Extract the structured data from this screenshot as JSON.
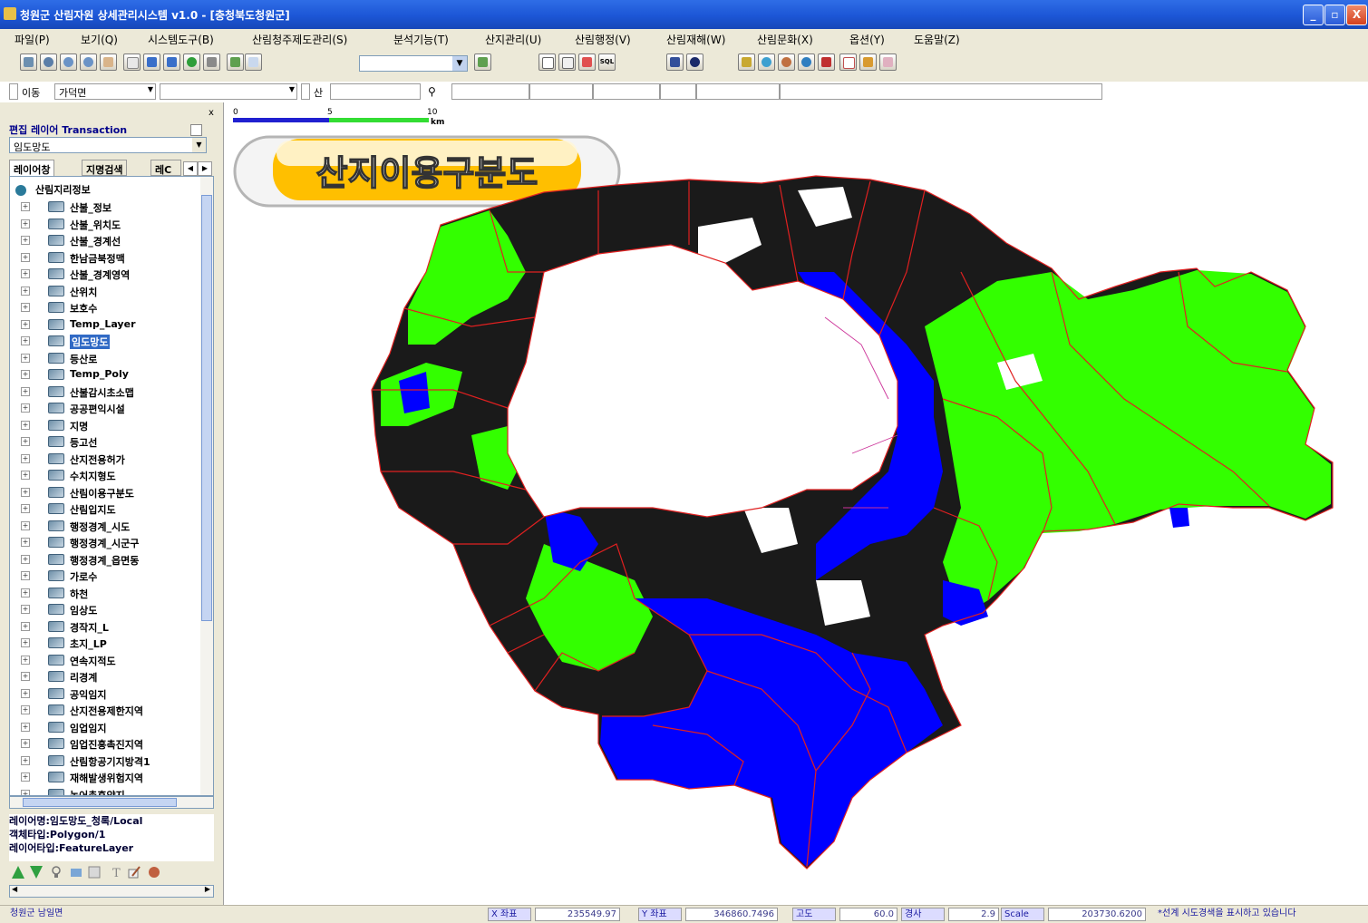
{
  "window": {
    "title": "청원군 산림자원 상세관리시스템 v1.0 - [충청북도청원군]",
    "min_label": "_",
    "restore_label": "▫",
    "close_label": "X"
  },
  "menu": [
    "파일(P)",
    "보기(Q)",
    "시스템도구(B)",
    "산림청주제도관리(S)",
    "분석기능(T)",
    "산지관리(U)",
    "산림행정(V)",
    "산림재해(W)",
    "산림문화(X)",
    "옵션(Y)",
    "도움말(Z)"
  ],
  "toolbar": {
    "layer_combo_value": "",
    "icons": [
      "print-preview-icon",
      "zoom-extent-icon",
      "zoom-in-icon",
      "zoom-out-icon",
      "pan-hand-icon",
      "select-arrow-icon",
      "previous-view-icon",
      "next-view-icon",
      "refresh-icon",
      "print-icon",
      "add-layer-icon",
      "add-data-icon",
      "select-tool-icon",
      "identify-icon",
      "query-icon",
      "sql-icon",
      "hyperlink-icon",
      "info-icon",
      "measure-icon",
      "globe-icon",
      "shade-icon",
      "globe2-icon",
      "symbol-icon",
      "edit-icon",
      "chart-icon",
      "brush-icon"
    ],
    "sql_label": "SQL"
  },
  "search": {
    "move_label": "이동",
    "region_value": "가덕면",
    "mountain_label": "산",
    "binoculars_icon": "binoculars-icon"
  },
  "left_panel": {
    "close_label": "x",
    "edit_layer_label": "편집 레이어 Transaction",
    "edit_layer_value": "임도망도",
    "tabs": [
      "레이어창",
      "지명검색",
      "레C"
    ],
    "tree_root": "산림지리정보",
    "layers": [
      "산불_정보",
      "산불_위치도",
      "산불_경계선",
      "한남금북정맥",
      "산불_경계영역",
      "산위치",
      "보호수",
      "Temp_Layer",
      "임도망도",
      "등산로",
      "Temp_Poly",
      "산불감시초소맵",
      "공공편익시설",
      "지명",
      "등고선",
      "산지전용허가",
      "수치지형도",
      "산림이용구분도",
      "산림입지도",
      "행정경계_시도",
      "행정경계_시군구",
      "행정경계_읍면동",
      "가로수",
      "하천",
      "임상도",
      "경작지_L",
      "초지_LP",
      "연속지적도",
      "리경계",
      "공익임지",
      "산지전용제한지역",
      "임업임지",
      "임업진흥촉진지역",
      "산림항공기지방격1",
      "재해발생위험지역",
      "농어촌휴양지"
    ],
    "selected_layer": "임도망도",
    "info": {
      "layer_name": "레이어명:임도망도_청록/Local",
      "object_type": "객체타입:Polygon/1",
      "layer_type": "레이어타입:FeatureLayer"
    },
    "bottom_tool_icons": [
      "move-up-icon",
      "move-down-icon",
      "bulb-icon",
      "properties-icon",
      "table-icon",
      "label-icon",
      "edit-icon",
      "paint-icon"
    ]
  },
  "map": {
    "title_badge": "산지이용구분도",
    "scale_ticks": [
      "0",
      "5",
      "10"
    ],
    "scale_unit": "km",
    "colors": {
      "green": "#33ff00",
      "blue": "#0000ff",
      "boundary": "#e02020",
      "dark": "#101010"
    }
  },
  "status": {
    "region": "청원군 남일면",
    "x_label": "X 좌표",
    "x_value": "235549.97",
    "y_label": "Y 좌표",
    "y_value": "346860.7496",
    "alt_label": "고도",
    "alt_value": "60.0",
    "slope_label": "경사",
    "slope_value": "2.9",
    "scale_label": "Scale",
    "scale_value": "203730.6200",
    "message": "*선계 시도경색을 표시하고 있습니다"
  }
}
